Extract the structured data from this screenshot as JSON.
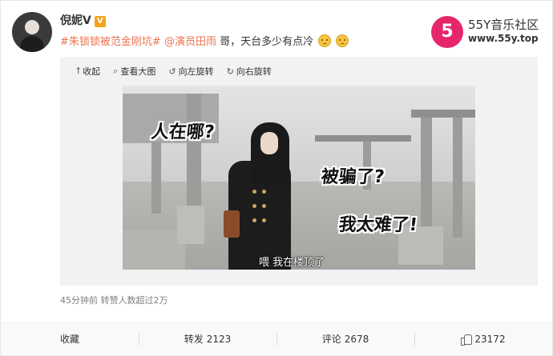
{
  "user": {
    "name": "倪妮V",
    "badge": "V"
  },
  "post": {
    "topic_tag": "#朱锁锁被范金刚坑#",
    "mention": "@演员田雨",
    "text": " 哥，天台多少有点冷",
    "emoji": "sad-face-icon"
  },
  "watermark": {
    "logo_number": "5",
    "name": "55Y音乐社区",
    "url": "www.55y.top"
  },
  "media_tools": [
    {
      "icon": "collapse-icon",
      "label": "收起"
    },
    {
      "icon": "zoom-icon",
      "label": "查看大图"
    },
    {
      "icon": "rotate-left-icon",
      "label": "向左旋转"
    },
    {
      "icon": "rotate-right-icon",
      "label": "向右旋转"
    }
  ],
  "image": {
    "bubble_1": "人在哪?",
    "bubble_2": "被骗了?",
    "bubble_3": "我太难了!",
    "caption": "喂 我在楼顶了"
  },
  "meta": {
    "time": "45分钟前",
    "note": "转赞人数超过2万"
  },
  "actions": {
    "collect_label": "收藏",
    "repost_label": "转发",
    "repost_count": "2123",
    "comment_label": "评论",
    "comment_count": "2678",
    "like_count": "23172"
  },
  "colors": {
    "link": "#eb7350",
    "badge": "#f3a31b",
    "logo": "#e6266a"
  }
}
